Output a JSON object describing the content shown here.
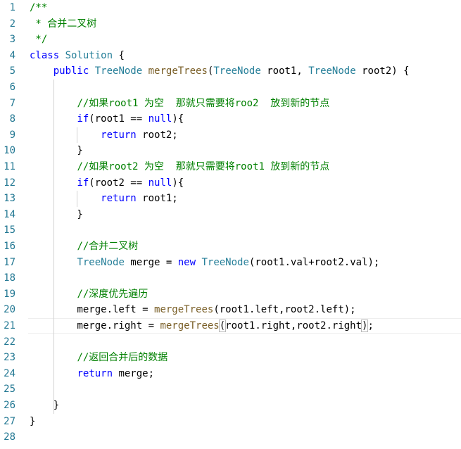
{
  "editor": {
    "lines": [
      {
        "n": "1",
        "parts": [
          {
            "t": "/**",
            "c": "cm"
          }
        ]
      },
      {
        "n": "2",
        "parts": [
          {
            "t": " * 合并二叉树",
            "c": "cm"
          }
        ]
      },
      {
        "n": "3",
        "parts": [
          {
            "t": " */",
            "c": "cm"
          }
        ]
      },
      {
        "n": "4",
        "parts": [
          {
            "t": "class",
            "c": "kw"
          },
          {
            "t": " ",
            "c": ""
          },
          {
            "t": "Solution",
            "c": "ty"
          },
          {
            "t": " {",
            "c": ""
          }
        ]
      },
      {
        "n": "5",
        "parts": [
          {
            "t": "    ",
            "c": ""
          },
          {
            "t": "public",
            "c": "kw"
          },
          {
            "t": " ",
            "c": ""
          },
          {
            "t": "TreeNode",
            "c": "ty"
          },
          {
            "t": " ",
            "c": ""
          },
          {
            "t": "mergeTrees",
            "c": "fn"
          },
          {
            "t": "(",
            "c": ""
          },
          {
            "t": "TreeNode",
            "c": "ty"
          },
          {
            "t": " root1, ",
            "c": ""
          },
          {
            "t": "TreeNode",
            "c": "ty"
          },
          {
            "t": " root2) {",
            "c": ""
          }
        ]
      },
      {
        "n": "6",
        "parts": []
      },
      {
        "n": "7",
        "parts": [
          {
            "t": "        ",
            "c": ""
          },
          {
            "t": "//如果root1 为空  那就只需要将roo2  放到新的节点",
            "c": "cm"
          }
        ]
      },
      {
        "n": "8",
        "parts": [
          {
            "t": "        ",
            "c": ""
          },
          {
            "t": "if",
            "c": "kw"
          },
          {
            "t": "(root1 == ",
            "c": ""
          },
          {
            "t": "null",
            "c": "kw"
          },
          {
            "t": "){",
            "c": ""
          }
        ]
      },
      {
        "n": "9",
        "parts": [
          {
            "t": "            ",
            "c": ""
          },
          {
            "t": "return",
            "c": "kw"
          },
          {
            "t": " root2;",
            "c": ""
          }
        ]
      },
      {
        "n": "10",
        "parts": [
          {
            "t": "        }",
            "c": ""
          }
        ]
      },
      {
        "n": "11",
        "parts": [
          {
            "t": "        ",
            "c": ""
          },
          {
            "t": "//如果root2 为空  那就只需要将root1 放到新的节点",
            "c": "cm"
          }
        ]
      },
      {
        "n": "12",
        "parts": [
          {
            "t": "        ",
            "c": ""
          },
          {
            "t": "if",
            "c": "kw"
          },
          {
            "t": "(root2 == ",
            "c": ""
          },
          {
            "t": "null",
            "c": "kw"
          },
          {
            "t": "){",
            "c": ""
          }
        ]
      },
      {
        "n": "13",
        "parts": [
          {
            "t": "            ",
            "c": ""
          },
          {
            "t": "return",
            "c": "kw"
          },
          {
            "t": " root1;",
            "c": ""
          }
        ]
      },
      {
        "n": "14",
        "parts": [
          {
            "t": "        }",
            "c": ""
          }
        ]
      },
      {
        "n": "15",
        "parts": []
      },
      {
        "n": "16",
        "parts": [
          {
            "t": "        ",
            "c": ""
          },
          {
            "t": "//合并二叉树",
            "c": "cm"
          }
        ]
      },
      {
        "n": "17",
        "parts": [
          {
            "t": "        ",
            "c": ""
          },
          {
            "t": "TreeNode",
            "c": "ty"
          },
          {
            "t": " merge = ",
            "c": ""
          },
          {
            "t": "new",
            "c": "kw"
          },
          {
            "t": " ",
            "c": ""
          },
          {
            "t": "TreeNode",
            "c": "ty"
          },
          {
            "t": "(root1.val+root2.val);",
            "c": ""
          }
        ]
      },
      {
        "n": "18",
        "parts": []
      },
      {
        "n": "19",
        "parts": [
          {
            "t": "        ",
            "c": ""
          },
          {
            "t": "//深度优先遍历",
            "c": "cm"
          }
        ]
      },
      {
        "n": "20",
        "parts": [
          {
            "t": "        merge.left = ",
            "c": ""
          },
          {
            "t": "mergeTrees",
            "c": "fn"
          },
          {
            "t": "(root1.left,root2.left);",
            "c": ""
          }
        ]
      },
      {
        "n": "21",
        "parts": [
          {
            "t": "        merge.right = ",
            "c": ""
          },
          {
            "t": "mergeTrees",
            "c": "fn"
          },
          {
            "t": "(",
            "c": "br"
          },
          {
            "t": "root1.right,root2.right",
            "c": ""
          },
          {
            "t": ")",
            "c": "br"
          },
          {
            "t": ";",
            "c": ""
          }
        ]
      },
      {
        "n": "22",
        "parts": []
      },
      {
        "n": "23",
        "parts": [
          {
            "t": "        ",
            "c": ""
          },
          {
            "t": "//返回合并后的数据",
            "c": "cm"
          }
        ]
      },
      {
        "n": "24",
        "parts": [
          {
            "t": "        ",
            "c": ""
          },
          {
            "t": "return",
            "c": "kw"
          },
          {
            "t": " merge;",
            "c": ""
          }
        ]
      },
      {
        "n": "25",
        "parts": []
      },
      {
        "n": "26",
        "parts": [
          {
            "t": "    }",
            "c": ""
          }
        ]
      },
      {
        "n": "27",
        "parts": [
          {
            "t": "}",
            "c": ""
          }
        ]
      },
      {
        "n": "28",
        "parts": []
      }
    ],
    "current_line": "21"
  }
}
